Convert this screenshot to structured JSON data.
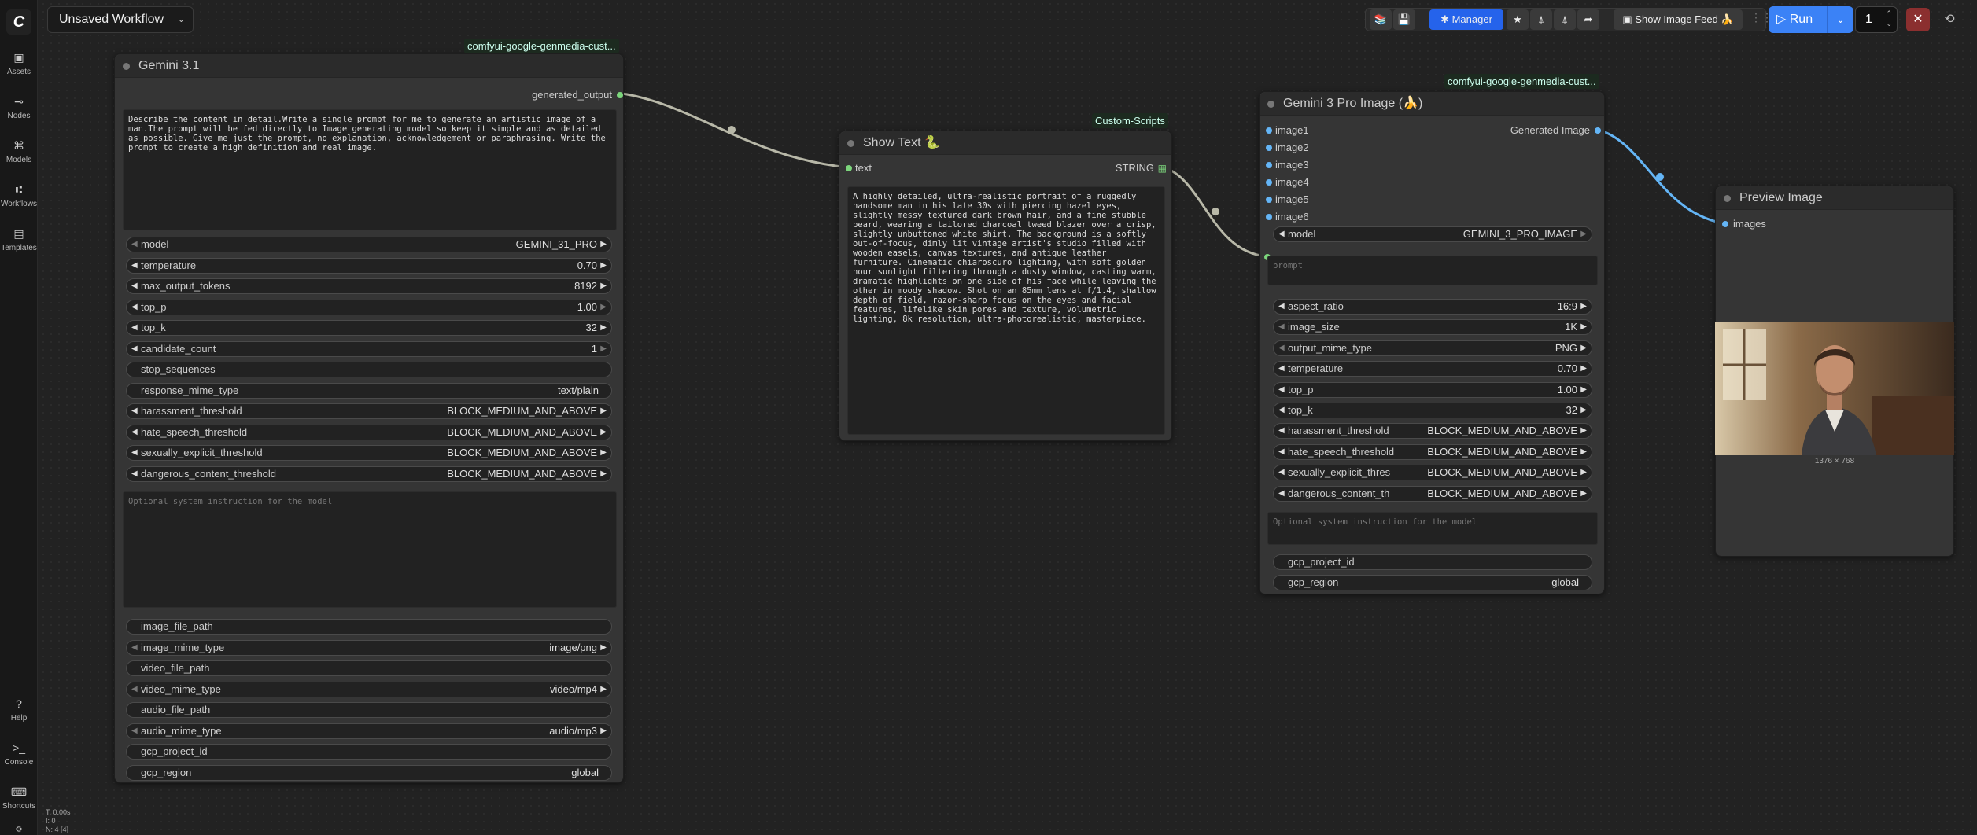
{
  "app": {
    "workflow_title": "Unsaved Workflow"
  },
  "sidebar": {
    "items": [
      {
        "label": "Assets",
        "icon": "folder-icon"
      },
      {
        "label": "Nodes",
        "icon": "nodes-icon"
      },
      {
        "label": "Models",
        "icon": "models-icon"
      },
      {
        "label": "Workflows",
        "icon": "workflows-icon"
      },
      {
        "label": "Templates",
        "icon": "templates-icon"
      }
    ],
    "bottom": [
      {
        "label": "Help",
        "icon": "help-icon"
      },
      {
        "label": "Console",
        "icon": "console-icon"
      },
      {
        "label": "Shortcuts",
        "icon": "keyboard-icon"
      }
    ]
  },
  "toolbar": {
    "manager_label": "Manager",
    "image_feed_label": "Show Image Feed 🍌",
    "run_label": "Run",
    "queue_count": "1"
  },
  "stats": {
    "line1": "T: 0.00s",
    "line2": "I: 0",
    "line3": "N: 4 [4]"
  },
  "nodes": {
    "gemini31": {
      "title": "Gemini 3.1",
      "badge": "comfyui-google-genmedia-cust...",
      "output": "generated_output",
      "prompt": "Describe the content in detail.Write a single prompt for me to generate an artistic image of a man.The prompt will be fed directly to Image generating model so keep it simple and as detailed as possible. Give me just the prompt, no explanation, acknowledgement or paraphrasing. Write the prompt to create a high definition and real image.",
      "widgets": [
        {
          "label": "model",
          "value": "GEMINI_31_PRO"
        },
        {
          "label": "temperature",
          "value": "0.70"
        },
        {
          "label": "max_output_tokens",
          "value": "8192"
        },
        {
          "label": "top_p",
          "value": "1.00"
        },
        {
          "label": "top_k",
          "value": "32"
        },
        {
          "label": "candidate_count",
          "value": "1"
        },
        {
          "label": "stop_sequences",
          "value": ""
        },
        {
          "label": "response_mime_type",
          "value": "text/plain"
        },
        {
          "label": "harassment_threshold",
          "value": "BLOCK_MEDIUM_AND_ABOVE"
        },
        {
          "label": "hate_speech_threshold",
          "value": "BLOCK_MEDIUM_AND_ABOVE"
        },
        {
          "label": "sexually_explicit_threshold",
          "value": "BLOCK_MEDIUM_AND_ABOVE"
        },
        {
          "label": "dangerous_content_threshold",
          "value": "BLOCK_MEDIUM_AND_ABOVE"
        }
      ],
      "system_placeholder": "Optional system instruction for the model",
      "widgets2": [
        {
          "label": "image_file_path",
          "value": ""
        },
        {
          "label": "image_mime_type",
          "value": "image/png"
        },
        {
          "label": "video_file_path",
          "value": ""
        },
        {
          "label": "video_mime_type",
          "value": "video/mp4"
        },
        {
          "label": "audio_file_path",
          "value": ""
        },
        {
          "label": "audio_mime_type",
          "value": "audio/mp3"
        },
        {
          "label": "gcp_project_id",
          "value": ""
        },
        {
          "label": "gcp_region",
          "value": "global"
        }
      ]
    },
    "showtext": {
      "title": "Show Text 🐍",
      "badge": "Custom-Scripts",
      "input": "text",
      "output": "STRING",
      "text": "A highly detailed, ultra-realistic portrait of a ruggedly handsome man in his late 30s with piercing hazel eyes, slightly messy textured dark brown hair, and a fine stubble beard, wearing a tailored charcoal tweed blazer over a crisp, slightly unbuttoned white shirt. The background is a softly out-of-focus, dimly lit vintage artist's studio filled with wooden easels, canvas textures, and antique leather furniture. Cinematic chiaroscuro lighting, with soft golden hour sunlight filtering through a dusty window, casting warm, dramatic highlights on one side of his face while leaving the other in moody shadow. Shot on an 85mm lens at f/1.4, shallow depth of field, razor-sharp focus on the eyes and facial features, lifelike skin pores and texture, volumetric lighting, 8k resolution, ultra-photorealistic, masterpiece."
    },
    "gemini3pro": {
      "title": "Gemini 3 Pro Image (🍌)",
      "badge": "comfyui-google-genmedia-cust...",
      "inputs": [
        "image1",
        "image2",
        "image3",
        "image4",
        "image5",
        "image6"
      ],
      "output": "Generated Image",
      "model_label": "model",
      "model_value": "GEMINI_3_PRO_IMAGE",
      "prompt_placeholder": "prompt",
      "widgets": [
        {
          "label": "aspect_ratio",
          "value": "16:9"
        },
        {
          "label": "image_size",
          "value": "1K"
        },
        {
          "label": "output_mime_type",
          "value": "PNG"
        },
        {
          "label": "temperature",
          "value": "0.70"
        },
        {
          "label": "top_p",
          "value": "1.00"
        },
        {
          "label": "top_k",
          "value": "32"
        },
        {
          "label": "harassment_threshold",
          "value": "BLOCK_MEDIUM_AND_ABOVE"
        },
        {
          "label": "hate_speech_threshold",
          "value": "BLOCK_MEDIUM_AND_ABOVE"
        },
        {
          "label": "sexually_explicit_thres",
          "value": "BLOCK_MEDIUM_AND_ABOVE"
        },
        {
          "label": "dangerous_content_th",
          "value": "BLOCK_MEDIUM_AND_ABOVE"
        }
      ],
      "system_placeholder": "Optional system instruction for the model",
      "widgets2": [
        {
          "label": "gcp_project_id",
          "value": ""
        },
        {
          "label": "gcp_region",
          "value": "global"
        }
      ]
    },
    "preview": {
      "title": "Preview Image",
      "input": "images",
      "caption": "1376 × 768"
    }
  },
  "colors": {
    "accent": "#3b82f6",
    "link_gray": "#b8b8a8",
    "link_blue": "#64b5f6",
    "slot_green": "#7cd67c"
  }
}
